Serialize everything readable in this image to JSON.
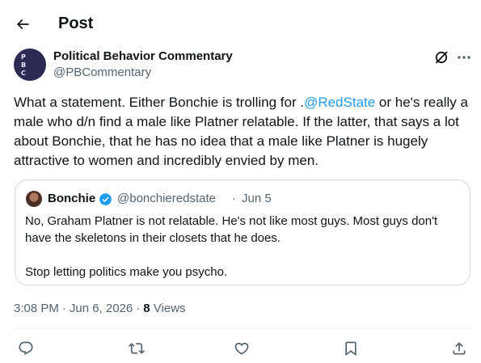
{
  "header": {
    "title": "Post"
  },
  "author": {
    "name": "Political Behavior Commentary",
    "handle": "@PBCommentary",
    "avatar_letters": [
      "P",
      "B",
      "C"
    ]
  },
  "post": {
    "text_before": "What a statement. Either Bonchie is trolling for .",
    "mention": "@RedState",
    "text_after": " or he's really a male who d/n find a male like Platner relatable. If the latter, that says a lot about Bonchie, that he has no idea that a male like Platner is hugely attractive to women and incredibly envied by men."
  },
  "quote": {
    "name": "Bonchie",
    "handle": "@bonchieredstate",
    "separator": "·",
    "date": "Jun 5",
    "text": "No, Graham Platner is not relatable. He's not like most guys. Most guys don't have the skeletons in their closets that he does.\n\nStop letting politics make you psycho."
  },
  "meta": {
    "time": "3:08 PM",
    "separator": "·",
    "date": "Jun 6, 2026",
    "views_count": "8",
    "views_label": " Views"
  },
  "icons": [
    "arrow-left",
    "grok",
    "more",
    "verified-badge",
    "reply",
    "repost",
    "like",
    "bookmark",
    "share"
  ],
  "colors": {
    "accent": "#1d9bf0",
    "secondary_text": "#536471",
    "border": "#cfd9de"
  }
}
